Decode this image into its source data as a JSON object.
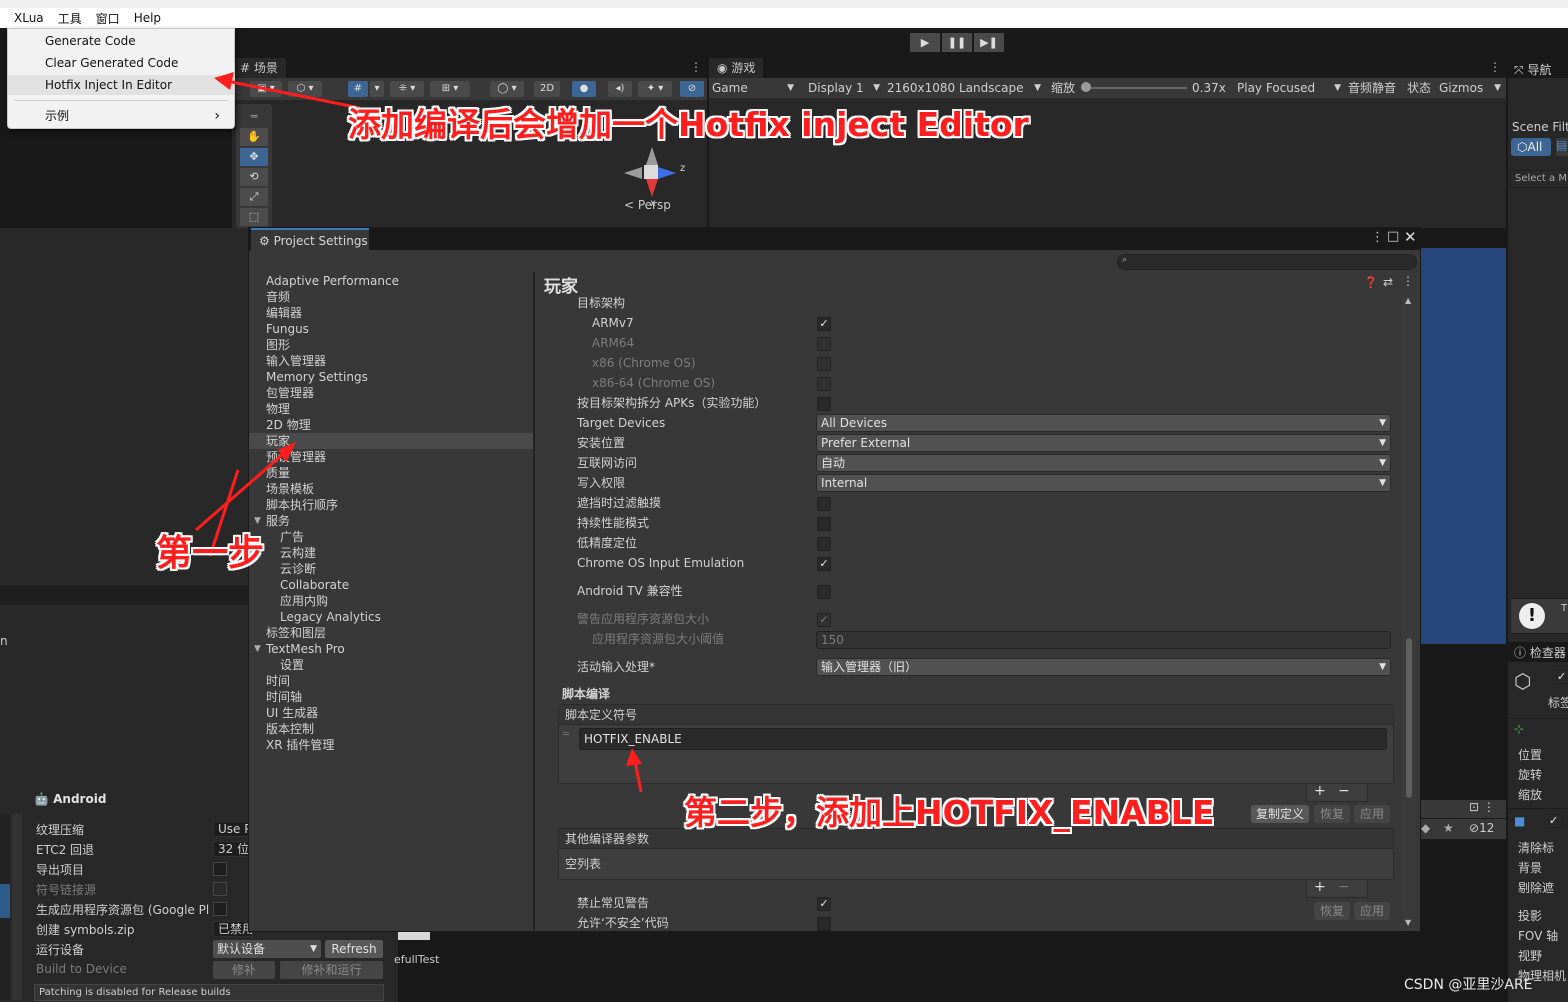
{
  "menubar": {
    "items": [
      "XLua",
      "工具",
      "窗口",
      "Help"
    ]
  },
  "xlua_menu": {
    "items": [
      "Generate Code",
      "Clear Generated Code",
      "Hotfix Inject In Editor"
    ],
    "submenu": {
      "label": "示例",
      "arrow": "›"
    }
  },
  "play_controls": {
    "play": "▶",
    "pause": "❚❚",
    "step": "▶❚"
  },
  "scene": {
    "tab": "场景",
    "button_2d": "2D",
    "persp_label": "< Persp",
    "axis_z": "z",
    "axis_x": "x"
  },
  "game": {
    "tab": "游戏",
    "view_dropdown": "Game",
    "display": "Display 1",
    "resolution": "2160x1080 Landscape",
    "scale_label": "缩放",
    "scale_value": "0.37x",
    "play_focused": "Play Focused",
    "mute": "音频静音",
    "stats": "状态",
    "gizmos": "Gizmos"
  },
  "nav": {
    "title": "导航",
    "scene_filter": "Scene Filt",
    "all_button": "All",
    "select_hint": "Select a M",
    "inspector": "检查器",
    "tag_label": "标签",
    "position": "位置",
    "rotation": "旋转",
    "scale": "缩放",
    "clear": "清除标",
    "background": "背景",
    "culling": "剔除遮",
    "projection": "投影",
    "fov_axis": "FOV 轴",
    "fov": "视野",
    "physical": "物理相机",
    "truncated_t": "T",
    "count_12": "12"
  },
  "build": {
    "platform": "Android",
    "rows": [
      {
        "label": "纹理压缩",
        "value": "Use P"
      },
      {
        "label": "ETC2 回退",
        "value": "32 位"
      },
      {
        "label": "导出项目",
        "value": ""
      },
      {
        "label": "符号链接源",
        "value": ""
      },
      {
        "label": "生成应用程序资源包 (Google Pl",
        "value": ""
      },
      {
        "label": "创建 symbols.zip",
        "value": "已禁用"
      },
      {
        "label": "运行设备",
        "value": "默认设备"
      }
    ],
    "refresh": "Refresh",
    "build_to_device": "Build to Device",
    "patch": "修补",
    "patch_and_run": "修补和运行",
    "patching_note": "Patching is disabled for Release builds",
    "hierarchy_partial": "n",
    "scene_name_partial": "efullTest"
  },
  "project_settings": {
    "title": "Project Settings",
    "tree": [
      "Adaptive Performance",
      "音频",
      "编辑器",
      "Fungus",
      "图形",
      "输入管理器",
      "Memory Settings",
      "包管理器",
      "物理",
      "2D 物理",
      "玩家",
      "预设管理器",
      "质量",
      "场景模板",
      "脚本执行顺序",
      "服务",
      "广告",
      "云构建",
      "云诊断",
      "Collaborate",
      "应用内购",
      "Legacy Analytics",
      "标签和图层",
      "TextMesh Pro",
      "设置",
      "时间",
      "时间轴",
      "UI 生成器",
      "版本控制",
      "XR 插件管理"
    ],
    "heading": "玩家",
    "target_arch": "目标架构",
    "archs": [
      "ARMv7",
      "ARM64",
      "x86 (Chrome OS)",
      "x86-64 (Chrome OS)"
    ],
    "split_apks": "按目标架构拆分 APKs（实验功能）",
    "target_devices": {
      "label": "Target Devices",
      "value": "All Devices"
    },
    "install_location": {
      "label": "安装位置",
      "value": "Prefer External"
    },
    "internet": {
      "label": "互联网访问",
      "value": "自动"
    },
    "write_perm": {
      "label": "写入权限",
      "value": "Internal"
    },
    "filter_touches": "遮挡时过滤触摸",
    "sustained_perf": "持续性能模式",
    "low_accuracy": "低精度定位",
    "chrome_input": "Chrome OS Input Emulation",
    "android_tv": "Android TV 兼容性",
    "warn_bundle": "警告应用程序资源包大小",
    "bundle_threshold": {
      "label": "应用程序资源包大小阈值",
      "value": "150"
    },
    "active_input": {
      "label": "活动输入处理*",
      "value": "输入管理器（旧）"
    },
    "script_compile": "脚本编译",
    "define_symbols": "脚本定义符号",
    "symbol_value": "HOTFIX_ENABLE",
    "copy_defines": "复制定义",
    "revert": "恢复",
    "apply": "应用",
    "extra_args": "其他编译器参数",
    "empty_list": "空列表",
    "suppress_warnings": "禁止常见警告",
    "allow_unsafe": "允许‘不安全’代码",
    "plus": "+",
    "minus": "−",
    "search_placeholder": ""
  },
  "annotations": {
    "note1": "添加编译后会增加一个Hotfix inject Editor",
    "note_step1": "第一步",
    "note_step2": "第二步，添加上HOTFIX_ENABLE",
    "watermark": "CSDN @亚里沙ARE",
    "color": "#ff1e1e"
  }
}
